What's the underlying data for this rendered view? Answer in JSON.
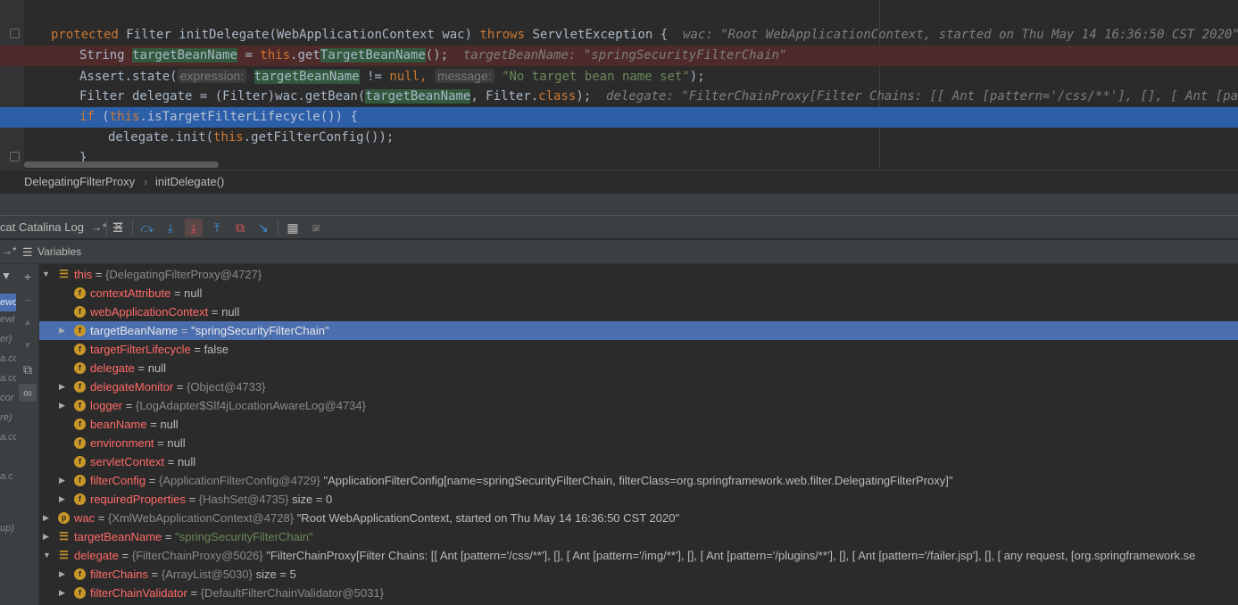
{
  "editor": {
    "lines": {
      "l1": {
        "kw": "protected",
        "code": "Filter initDelegate(WebApplicationContext wac)",
        "throws": "throws",
        "rest": "ServletException {",
        "inline": "wac: \"Root WebApplicationContext, started on Thu May 14 16:36:50 CST 2020\""
      },
      "l2": {
        "a": "String",
        "b": "targetBeanName",
        "c": " = ",
        "d": "this",
        "e": ".get",
        "f": "TargetBeanName",
        "g": "();",
        "inline": "targetBeanName: \"springSecurityFilterChain\""
      },
      "l3": {
        "a": "Assert.state(",
        "hint1": "expression:",
        "b": "targetBeanName",
        "c": " != ",
        "d": "null,",
        "hint2": "message:",
        "e": "\"No target bean name set\"",
        "f": ");"
      },
      "l4": {
        "a": "Filter delegate = (Filter)wac.getBean(",
        "b": "targetBeanName",
        "c": ", Filter.",
        "d": "class",
        "e": ");",
        "inline": "delegate: \"FilterChainProxy[Filter Chains: [[ Ant [pattern='/css/**'], [], [ Ant [pattern='"
      },
      "l5": {
        "a": "if",
        "b": " (",
        "c": "this",
        "d": ".isTargetFilterLifecycle()) {"
      },
      "l6": {
        "a": "delegate.init(",
        "b": "this",
        "c": ".getFilterConfig());"
      },
      "l7": {
        "a": "}"
      }
    }
  },
  "breadcrumb": {
    "class_name": "DelegatingFilterProxy",
    "separator": "›",
    "method": "initDelegate()"
  },
  "debug_toolbar": {
    "tab_label": "cat Catalina Log",
    "tab_suffix": "→*",
    "icons": [
      "show-execution-point",
      "step-over",
      "step-into",
      "force-step-into",
      "step-out",
      "drop-frame",
      "run-to-cursor",
      "evaluate-expression",
      "trace-current-stream"
    ]
  },
  "variables_panel": {
    "title": "Variables",
    "pin": "→*"
  },
  "frames_strip": [
    "ewo",
    "ewi",
    "er)",
    "a.co",
    "a.co",
    "cor",
    "re)",
    "a.co",
    "a.c",
    "up)"
  ],
  "variables": [
    {
      "name": "this",
      "eq": "=",
      "type": "{DelegatingFilterProxy@4727}",
      "value": ""
    },
    {
      "name": "contextAttribute",
      "eq": "=",
      "type": "",
      "value": "null"
    },
    {
      "name": "webApplicationContext",
      "eq": "=",
      "type": "",
      "value": "null"
    },
    {
      "name": "targetBeanName",
      "eq": "=",
      "type": "",
      "value": "\"springSecurityFilterChain\""
    },
    {
      "name": "targetFilterLifecycle",
      "eq": "=",
      "type": "",
      "value": "false"
    },
    {
      "name": "delegate",
      "eq": "=",
      "type": "",
      "value": "null"
    },
    {
      "name": "delegateMonitor",
      "eq": "=",
      "type": "{Object@4733}",
      "value": ""
    },
    {
      "name": "logger",
      "eq": "=",
      "type": "{LogAdapter$Slf4jLocationAwareLog@4734}",
      "value": ""
    },
    {
      "name": "beanName",
      "eq": "=",
      "type": "",
      "value": "null"
    },
    {
      "name": "environment",
      "eq": "=",
      "type": "",
      "value": "null"
    },
    {
      "name": "servletContext",
      "eq": "=",
      "type": "",
      "value": "null"
    },
    {
      "name": "filterConfig",
      "eq": "=",
      "type": "{ApplicationFilterConfig@4729}",
      "value": "\"ApplicationFilterConfig[name=springSecurityFilterChain, filterClass=org.springframework.web.filter.DelegatingFilterProxy]\""
    },
    {
      "name": "requiredProperties",
      "eq": "=",
      "type": "{HashSet@4735}",
      "value": "size = 0"
    },
    {
      "name": "wac",
      "eq": "=",
      "type": "{XmlWebApplicationContext@4728}",
      "value": "\"Root WebApplicationContext, started on Thu May 14 16:36:50 CST 2020\""
    },
    {
      "name": "targetBeanName",
      "eq": "=",
      "type": "",
      "value": "\"springSecurityFilterChain\""
    },
    {
      "name": "delegate",
      "eq": "=",
      "type": "{FilterChainProxy@5026}",
      "value": "\"FilterChainProxy[Filter Chains: [[ Ant [pattern='/css/**'], [], [ Ant [pattern='/img/**'], [], [ Ant [pattern='/plugins/**'], [], [ Ant [pattern='/failer.jsp'], [], [ any request, [org.springframework.se"
    },
    {
      "name": "filterChains",
      "eq": "=",
      "type": "{ArrayList@5030}",
      "value": "size = 5"
    },
    {
      "name": "filterChainValidator",
      "eq": "=",
      "type": "{DefaultFilterChainValidator@5031}",
      "value": ""
    }
  ],
  "badges": {
    "field": "f",
    "param": "p"
  },
  "colors": {
    "selection": "#4b6eaf",
    "execution_line": "#2d5fa8",
    "error_line": "#4e2a2a",
    "field_name": "#ff6b68",
    "string": "#6a8759",
    "keyword": "#cc7832"
  }
}
